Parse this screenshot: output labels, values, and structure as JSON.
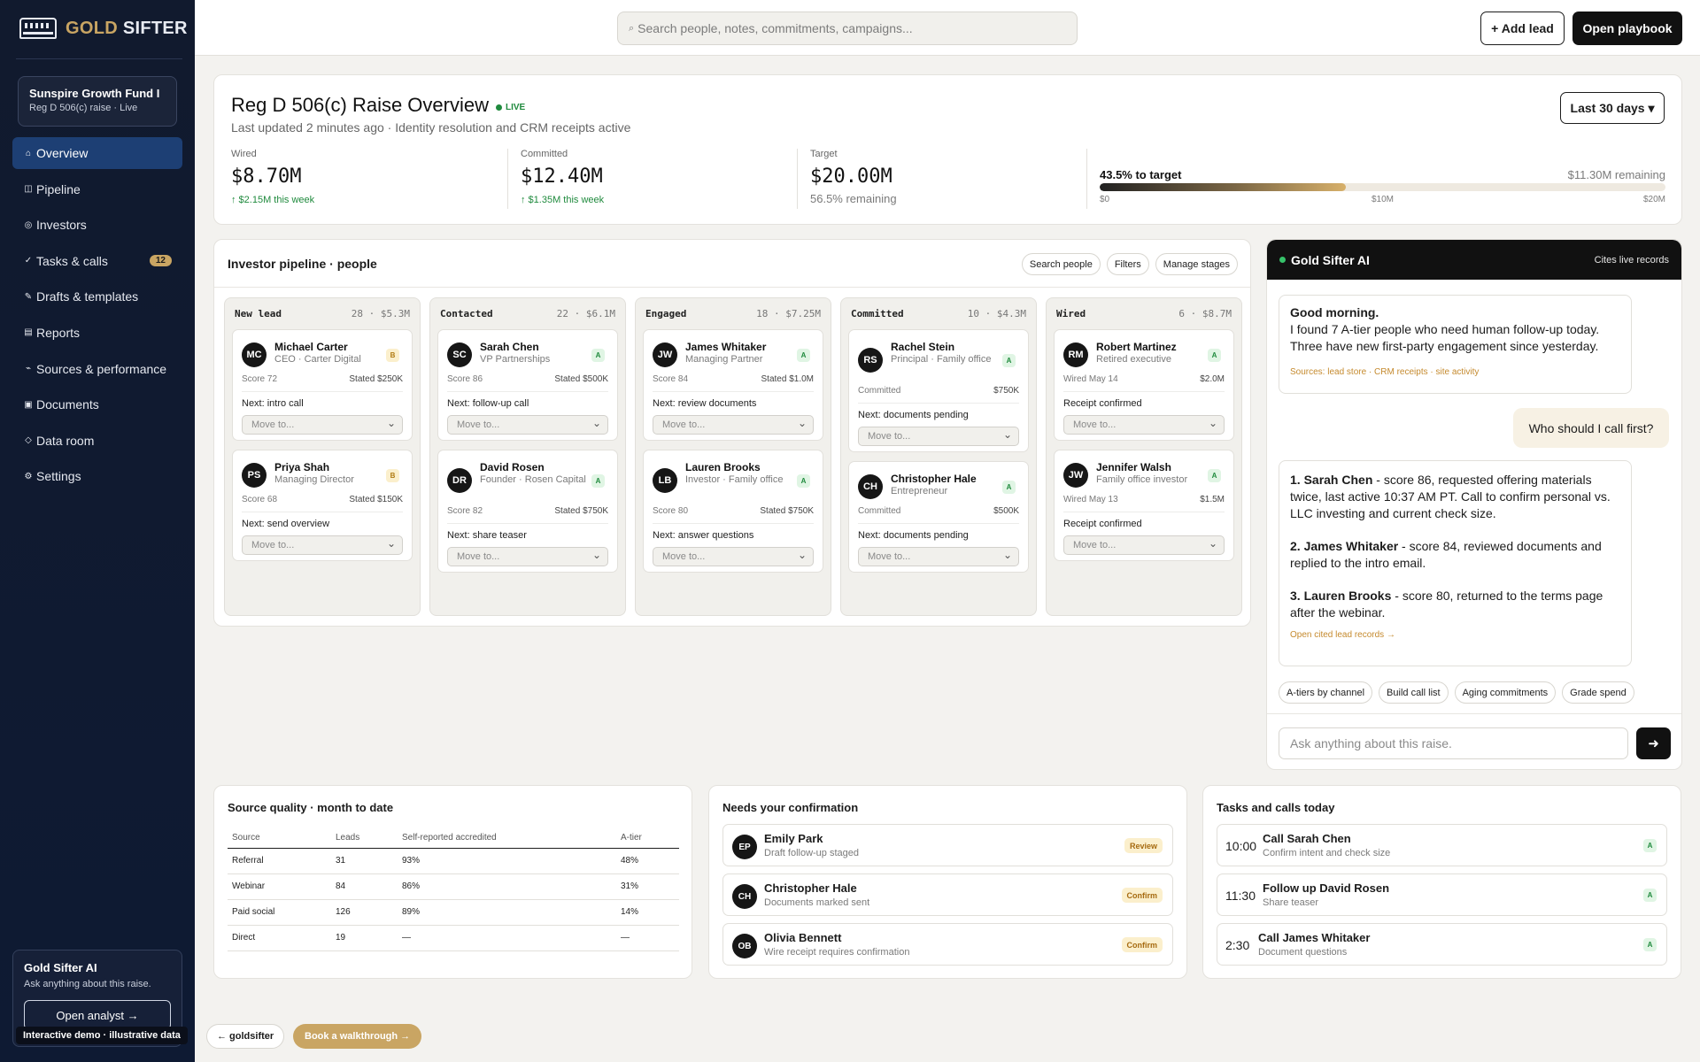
{
  "brand": {
    "name_a": "GOLD",
    "name_b": " SIFTER"
  },
  "fund": {
    "name": "Sunspire Growth Fund I",
    "sub": "Reg D 506(c) raise · Live"
  },
  "nav": [
    {
      "icon": "⌂",
      "label": "Overview",
      "active": true
    },
    {
      "icon": "◫",
      "label": "Pipeline"
    },
    {
      "icon": "◎",
      "label": "Investors"
    },
    {
      "icon": "✓",
      "label": "Tasks & calls",
      "badge": "12"
    },
    {
      "icon": "✎",
      "label": "Drafts & templates"
    },
    {
      "icon": "▤",
      "label": "Reports"
    },
    {
      "icon": "⌁",
      "label": "Sources & performance"
    },
    {
      "icon": "▣",
      "label": "Documents"
    },
    {
      "icon": "◇",
      "label": "Data room"
    },
    {
      "icon": "⚙",
      "label": "Settings"
    }
  ],
  "sidebar_ai": {
    "title": "Gold Sifter AI",
    "sub": "Ask anything about this raise.",
    "button": "Open analyst →"
  },
  "demo_badge": "Interactive demo · illustrative data",
  "topbar": {
    "search_placeholder": "Search people, notes, commitments, campaigns...",
    "search_icon": "⌕",
    "add_lead": "+ Add lead",
    "playbook": "Open playbook"
  },
  "overview": {
    "title": "Reg D 506(c) Raise Overview",
    "live": "LIVE",
    "subtitle": "Last updated 2 minutes ago · Identity resolution and CRM receipts active",
    "period": "Last 30 days ▾",
    "metrics": [
      {
        "label": "Wired",
        "value": "$8.70M",
        "delta": "↑ $2.15M this week"
      },
      {
        "label": "Committed",
        "value": "$12.40M",
        "delta": "↑ $1.35M this week"
      },
      {
        "label": "Target",
        "value": "$20.00M",
        "delta": "56.5% remaining"
      }
    ],
    "progress": {
      "label": "43.5% to target",
      "remaining": "$11.30M remaining",
      "fraction": 0.435,
      "ticks": [
        "$0",
        "$10M",
        "$20M"
      ]
    }
  },
  "pipeline": {
    "title": "Investor pipeline · people",
    "tools": [
      "Search people",
      "Filters",
      "Manage stages"
    ],
    "move_placeholder": "Move to...",
    "columns": [
      {
        "name": "New lead",
        "meta": "28 · $5.3M",
        "cards": [
          {
            "initials": "MC",
            "name": "Michael Carter",
            "role": "CEO · Carter Digital",
            "grade": "B",
            "left": "Score 72",
            "right": "Stated $250K",
            "next": "Next: intro call"
          },
          {
            "initials": "PS",
            "name": "Priya Shah",
            "role": "Managing Director",
            "grade": "B",
            "left": "Score 68",
            "right": "Stated $150K",
            "next": "Next: send overview"
          }
        ]
      },
      {
        "name": "Contacted",
        "meta": "22 · $6.1M",
        "cards": [
          {
            "initials": "SC",
            "name": "Sarah Chen",
            "role": "VP Partnerships",
            "grade": "A",
            "left": "Score 86",
            "right": "Stated $500K",
            "next": "Next: follow-up call"
          },
          {
            "initials": "DR",
            "name": "David Rosen",
            "role": "Founder · Rosen Capital",
            "grade": "A",
            "left": "Score 82",
            "right": "Stated $750K",
            "next": "Next: share teaser"
          }
        ]
      },
      {
        "name": "Engaged",
        "meta": "18 · $7.25M",
        "cards": [
          {
            "initials": "JW",
            "name": "James Whitaker",
            "role": "Managing Partner",
            "grade": "A",
            "left": "Score 84",
            "right": "Stated $1.0M",
            "next": "Next: review documents"
          },
          {
            "initials": "LB",
            "name": "Lauren Brooks",
            "role": "Investor · Family office",
            "grade": "A",
            "left": "Score 80",
            "right": "Stated $750K",
            "next": "Next: answer questions"
          }
        ]
      },
      {
        "name": "Committed",
        "meta": "10 · $4.3M",
        "cards": [
          {
            "initials": "RS",
            "name": "Rachel Stein",
            "role": "Principal · Family office",
            "grade": "A",
            "left": "Committed",
            "right": "$750K",
            "next": "Next: documents pending"
          },
          {
            "initials": "CH",
            "name": "Christopher Hale",
            "role": "Entrepreneur",
            "grade": "A",
            "left": "Committed",
            "right": "$500K",
            "next": "Next: documents pending"
          }
        ]
      },
      {
        "name": "Wired",
        "meta": "6 · $8.7M",
        "cards": [
          {
            "initials": "RM",
            "name": "Robert Martinez",
            "role": "Retired executive",
            "grade": "A",
            "left": "Wired May 14",
            "right": "$2.0M",
            "next": "Receipt confirmed"
          },
          {
            "initials": "JW",
            "name": "Jennifer Walsh",
            "role": "Family office investor",
            "grade": "A",
            "left": "Wired May 13",
            "right": "$1.5M",
            "next": "Receipt confirmed"
          }
        ]
      }
    ]
  },
  "ai": {
    "title": "Gold Sifter AI",
    "cites": "Cites live records",
    "greeting": "Good morning.",
    "greeting_body": "I found 7 A-tier people who need human follow-up today. Three have new first-party engagement since yesterday.",
    "greeting_sources": "Sources: lead store · CRM receipts · site activity",
    "user_question": "Who should I call first?",
    "recommendations": [
      {
        "name": "1. Sarah Chen",
        "text": " - score 86, requested offering materials twice, last active 10:37 AM PT. Call to confirm personal vs. LLC investing and current check size."
      },
      {
        "name": "2. James Whitaker",
        "text": " - score 84, reviewed documents and replied to the intro email."
      },
      {
        "name": "3. Lauren Brooks",
        "text": " - score 80, returned to the terms page after the webinar."
      }
    ],
    "rec_link": "Open cited lead records →",
    "suggestions": [
      "A-tiers by channel",
      "Build call list",
      "Aging commitments",
      "Grade spend"
    ],
    "input_placeholder": "Ask anything about this raise.",
    "send_icon": "➜"
  },
  "source_quality": {
    "title": "Source quality · month to date",
    "headers": [
      "Source",
      "Leads",
      "Self-reported accredited",
      "A-tier"
    ],
    "rows": [
      [
        "Referral",
        "31",
        "93%",
        "48%"
      ],
      [
        "Webinar",
        "84",
        "86%",
        "31%"
      ],
      [
        "Paid social",
        "126",
        "89%",
        "14%"
      ],
      [
        "Direct",
        "19",
        "—",
        "—"
      ]
    ]
  },
  "confirmation": {
    "title": "Needs your confirmation",
    "items": [
      {
        "initials": "EP",
        "name": "Emily Park",
        "sub": "Draft follow-up staged",
        "tag": "Review"
      },
      {
        "initials": "CH",
        "name": "Christopher Hale",
        "sub": "Documents marked sent",
        "tag": "Confirm"
      },
      {
        "initials": "OB",
        "name": "Olivia Bennett",
        "sub": "Wire receipt requires confirmation",
        "tag": "Confirm"
      }
    ]
  },
  "tasks": {
    "title": "Tasks and calls today",
    "items": [
      {
        "time": "10:00",
        "name": "Call Sarah Chen",
        "sub": "Confirm intent and check size",
        "grade": "A"
      },
      {
        "time": "11:30",
        "name": "Follow up David Rosen",
        "sub": "Share teaser",
        "grade": "A"
      },
      {
        "time": "2:30",
        "name": "Call James Whitaker",
        "sub": "Document questions",
        "grade": "A"
      }
    ]
  },
  "footer": {
    "back": "← goldsifter",
    "walkthrough": "Book a walkthrough →"
  }
}
